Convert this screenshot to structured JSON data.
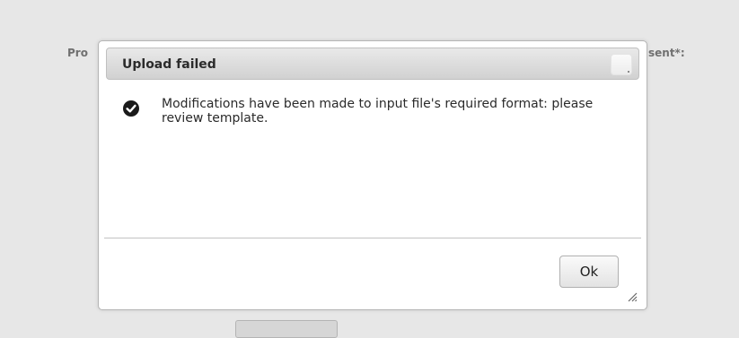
{
  "background": {
    "left_label": "Pro",
    "right_label": "sent*:"
  },
  "dialog": {
    "title": "Upload failed",
    "message": "Modifications have been made to input file's required format: please review template.",
    "message_icon": "check-circle-icon",
    "ok_label": "Ok"
  }
}
